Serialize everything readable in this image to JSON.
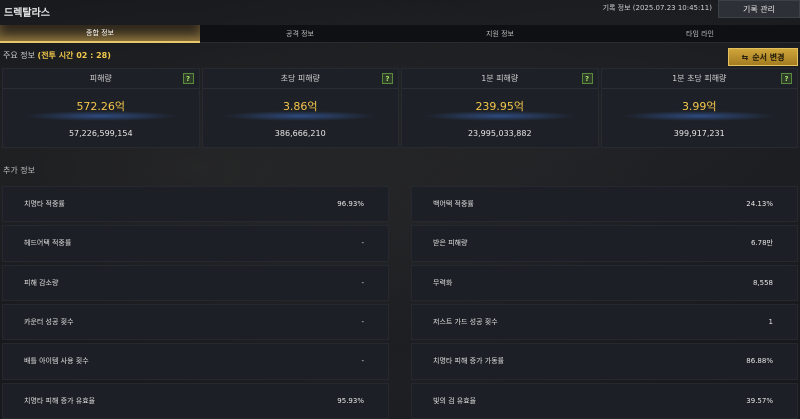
{
  "header": {
    "title": "드렉탈라스",
    "record_info": "기록 정보 (2025.07.23 10:45:11)",
    "record_button": "기록 관리"
  },
  "tabs": [
    {
      "label": "종합 정보",
      "active": true
    },
    {
      "label": "공격 정보",
      "active": false
    },
    {
      "label": "지원 정보",
      "active": false
    },
    {
      "label": "타임 라인",
      "active": false
    }
  ],
  "main": {
    "title": "주요 정보",
    "battle_time": "(전투 시간 02 : 28)",
    "order_button": "순서 변경"
  },
  "cards": [
    {
      "label": "피해량",
      "main": "572.26억",
      "sub": "57,226,599,154"
    },
    {
      "label": "초당 피해량",
      "main": "3.86억",
      "sub": "386,666,210"
    },
    {
      "label": "1분 피해량",
      "main": "239.95억",
      "sub": "23,995,033,882"
    },
    {
      "label": "1분 초당 피해량",
      "main": "3.99억",
      "sub": "399,917,231"
    }
  ],
  "help_glyph": "?",
  "additional": {
    "title": "추가 정보",
    "left": [
      {
        "label": "치명타 적중률",
        "value": "96.93%"
      },
      {
        "label": "헤드어택 적중률",
        "value": "-"
      },
      {
        "label": "피해 감소량",
        "value": "-"
      },
      {
        "label": "카운터 성공 횟수",
        "value": "-"
      },
      {
        "label": "배틀 아이템 사용 횟수",
        "value": "-"
      },
      {
        "label": "치명타 피해 증가 유효율",
        "value": "95.93%"
      }
    ],
    "right": [
      {
        "label": "백어택 적중률",
        "value": "24.13%"
      },
      {
        "label": "받은 피해량",
        "value": "6.78만"
      },
      {
        "label": "무력화",
        "value": "8,558"
      },
      {
        "label": "저스트 가드 성공 횟수",
        "value": "1"
      },
      {
        "label": "치명타 피해 증가 가동률",
        "value": "86.88%"
      },
      {
        "label": "빛의 검 유효율",
        "value": "39.57%"
      }
    ]
  },
  "colors": {
    "accent": "#f4c64a",
    "tab_active": "#e6c76a",
    "help": "#a6e06a"
  }
}
